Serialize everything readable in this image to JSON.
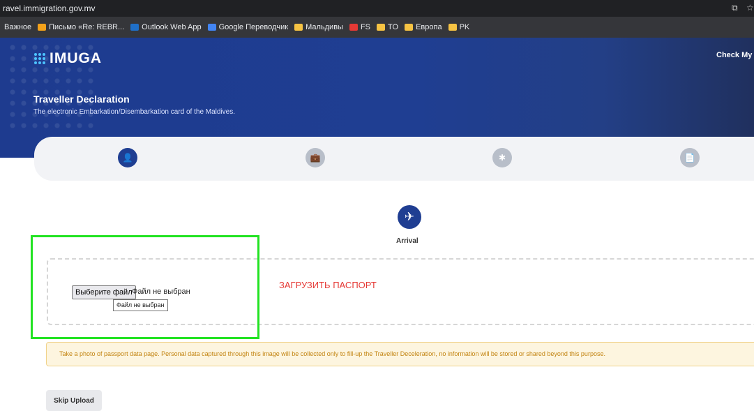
{
  "browser": {
    "url": "ravel.immigration.gov.mv",
    "bookmarks": [
      {
        "label": "Важное",
        "icon_color": ""
      },
      {
        "label": "Письмо «Re: REBR...",
        "icon_color": "#f4a21a"
      },
      {
        "label": "Outlook Web App",
        "icon_color": "#1f6fc7"
      },
      {
        "label": "Google Переводчик",
        "icon_color": "#4285f4"
      },
      {
        "label": "Мальдивы",
        "icon_color": "#f6c343"
      },
      {
        "label": "FS",
        "icon_color": "#e53935"
      },
      {
        "label": "TO",
        "icon_color": "#f6c343"
      },
      {
        "label": "Европа",
        "icon_color": "#f6c343"
      },
      {
        "label": "PK",
        "icon_color": "#f6c343"
      }
    ]
  },
  "header": {
    "logo": "IMUGA",
    "check": "Check My O",
    "title": "Traveller Declaration",
    "subtitle": "The electronic Embarkation/Disembarkation card of the Maldives."
  },
  "steps": [
    {
      "icon": "user-icon",
      "glyph": "👤",
      "active": true
    },
    {
      "icon": "briefcase-icon",
      "glyph": "💼",
      "active": false
    },
    {
      "icon": "asterisk-icon",
      "glyph": "✱",
      "active": false
    },
    {
      "icon": "document-icon",
      "glyph": "📄",
      "active": false
    }
  ],
  "arrival": {
    "label": "Arrival",
    "icon": "airplane-arrival-icon"
  },
  "upload": {
    "button": "Выберите файл",
    "status": "Файл не выбран",
    "tooltip": "Файл не выбран",
    "label": "ЗАГРУЗИТЬ ПАСПОРТ"
  },
  "notice": "Take a photo of passport data page. Personal data captured through this image will be collected only to fill-up the Traveller Deceleration, no information will be stored or shared beyond this purpose.",
  "skip_label": "Skip Upload",
  "colors": {
    "primary": "#1f3e92",
    "highlight": "#22e322",
    "upload_text": "#e53935",
    "notice": "#c2830f"
  }
}
